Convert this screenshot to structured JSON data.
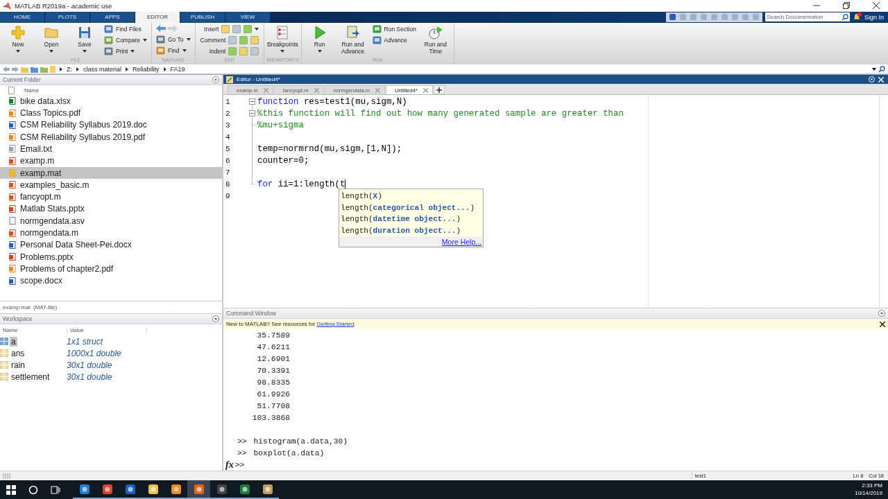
{
  "window": {
    "title": "MATLAB R2019a - academic use"
  },
  "ribbon": {
    "tabs": [
      {
        "label": "HOME",
        "selected": false
      },
      {
        "label": "PLOTS",
        "selected": false
      },
      {
        "label": "APPS",
        "selected": false
      },
      {
        "label": "EDITOR",
        "selected": true
      },
      {
        "label": "PUBLISH",
        "selected": false
      },
      {
        "label": "VIEW",
        "selected": false
      }
    ],
    "search": {
      "placeholder": "Search Documentation"
    },
    "sign_in": "Sign In"
  },
  "toolstrip": {
    "groups": [
      {
        "label": "FILE",
        "items": [
          {
            "kind": "big",
            "label": "New",
            "dropdown": true
          },
          {
            "kind": "big",
            "label": "Open",
            "dropdown": true
          },
          {
            "kind": "big",
            "label": "Save",
            "dropdown": true
          },
          {
            "kind": "stack",
            "buttons": [
              {
                "kind": "text",
                "label": "Find Files",
                "dropdown": false
              },
              {
                "kind": "text",
                "label": "Compare",
                "dropdown": true
              },
              {
                "kind": "text",
                "label": "Print",
                "dropdown": true
              }
            ]
          }
        ]
      },
      {
        "label": "NAVIGATE",
        "items": [
          {
            "kind": "stack",
            "buttons": [
              {
                "kind": "arrows"
              },
              {
                "kind": "text",
                "label": "Go To",
                "dropdown": true
              },
              {
                "kind": "text",
                "label": "Find",
                "dropdown": true
              }
            ]
          }
        ]
      },
      {
        "label": "EDIT",
        "items": [
          {
            "kind": "rows",
            "rows": [
              {
                "label": "Insert",
                "dropdown": true
              },
              {
                "label": "Comment",
                "dropdown": false
              },
              {
                "label": "Indent",
                "dropdown": false
              }
            ]
          }
        ]
      },
      {
        "label": "BREAKPOINTS",
        "items": [
          {
            "kind": "big",
            "label": "Breakpoints",
            "dropdown": true
          }
        ]
      },
      {
        "label": "RUN",
        "items": [
          {
            "kind": "big",
            "label": "Run",
            "dropdown": true
          },
          {
            "kind": "big",
            "label": "Run and Advance",
            "dropdown": false
          },
          {
            "kind": "stack",
            "buttons": [
              {
                "kind": "text",
                "label": "Run Section",
                "dropdown": false
              },
              {
                "kind": "text",
                "label": "Advance",
                "dropdown": false
              }
            ]
          },
          {
            "kind": "big",
            "label": "Run and Time",
            "dropdown": false
          }
        ]
      }
    ]
  },
  "address": {
    "crumbs": [
      "Z:",
      "class material",
      "Reliability",
      "FA19"
    ]
  },
  "current_folder": {
    "title": "Current Folder",
    "column": "Name",
    "files": [
      {
        "name": "bike data.xlsx",
        "kind": "excel",
        "selected": false
      },
      {
        "name": "Class Topics.pdf",
        "kind": "pdf",
        "selected": false
      },
      {
        "name": "CSM Reliability Syllabus 2019.doc",
        "kind": "word",
        "selected": false
      },
      {
        "name": "CSM Reliability Syllabus 2019.pdf",
        "kind": "pdf",
        "selected": false
      },
      {
        "name": "Email.txt",
        "kind": "text",
        "selected": false
      },
      {
        "name": "examp.m",
        "kind": "script",
        "selected": false
      },
      {
        "name": "examp.mat",
        "kind": "mat",
        "selected": true
      },
      {
        "name": "examples_basic.m",
        "kind": "script",
        "selected": false
      },
      {
        "name": "fancyopt.m",
        "kind": "function",
        "selected": false
      },
      {
        "name": "Matlab Stats.pptx",
        "kind": "slides",
        "selected": false
      },
      {
        "name": "normgendata.asv",
        "kind": "blank",
        "selected": false
      },
      {
        "name": "normgendata.m",
        "kind": "function",
        "selected": false
      },
      {
        "name": "Personal Data Sheet-Pei.docx",
        "kind": "word",
        "selected": false
      },
      {
        "name": "Problems.pptx",
        "kind": "slides",
        "selected": false
      },
      {
        "name": "Problems of chapter2.pdf",
        "kind": "pdf",
        "selected": false
      },
      {
        "name": "scope.docx",
        "kind": "word",
        "selected": false
      }
    ],
    "details": "examp.mat  (MAT-file)"
  },
  "workspace": {
    "title": "Workspace",
    "columns": [
      "Name",
      "Value"
    ],
    "rows": [
      {
        "name": "a",
        "value": "1x1 struct",
        "kind": "struct",
        "selected": true
      },
      {
        "name": "ans",
        "value": "1000x1 double",
        "kind": "matrix",
        "selected": false
      },
      {
        "name": "rain",
        "value": "30x1 double",
        "kind": "matrix",
        "selected": false
      },
      {
        "name": "settlement",
        "value": "30x1 double",
        "kind": "matrix",
        "selected": false
      }
    ]
  },
  "editor": {
    "title": "Editor - Untitled4*",
    "tabs": [
      {
        "label": "examp.m",
        "selected": false
      },
      {
        "label": "fancyopt.m",
        "selected": false
      },
      {
        "label": "normgendata.m",
        "selected": false
      },
      {
        "label": "Untitled4*",
        "selected": true
      }
    ],
    "lines": [
      {
        "num": "1",
        "fold_start": true,
        "fold_end": false,
        "cursor": false,
        "segments": [
          {
            "text": "function",
            "kind": "keyword"
          },
          {
            "text": " res=test1(mu,sigm,N)",
            "kind": "plain"
          }
        ]
      },
      {
        "num": "2",
        "fold_start": true,
        "fold_end": false,
        "cursor": false,
        "segments": [
          {
            "text": "%this function will find out how many generated sample are greater than",
            "kind": "comment"
          }
        ]
      },
      {
        "num": "3",
        "fold_start": false,
        "fold_end": true,
        "cursor": false,
        "segments": [
          {
            "text": "%mu+sigma",
            "kind": "comment"
          }
        ]
      },
      {
        "num": "4",
        "fold_start": false,
        "fold_end": false,
        "cursor": false
      },
      {
        "num": "5",
        "fold_start": false,
        "fold_end": false,
        "cursor": false,
        "segments": [
          {
            "text": "temp=normrnd(mu,sigm,[1,N]);",
            "kind": "plain"
          }
        ]
      },
      {
        "num": "6",
        "fold_start": false,
        "fold_end": false,
        "cursor": false,
        "segments": [
          {
            "text": "counter=0;",
            "kind": "plain"
          }
        ]
      },
      {
        "num": "7",
        "fold_start": false,
        "fold_end": false,
        "cursor": false
      },
      {
        "num": "8",
        "fold_start": false,
        "fold_end": true,
        "cursor": true,
        "segments": [
          {
            "text": "for",
            "kind": "keyword"
          },
          {
            "text": " ii=1:length(t",
            "kind": "plain"
          }
        ]
      },
      {
        "num": "9",
        "fold_start": false,
        "fold_end": false,
        "cursor": false
      }
    ],
    "completion": {
      "items": [
        "length(**X**)",
        "length(**categorical object...**)",
        "length(**datetime object...**)",
        "length(**duration object...**)"
      ],
      "more": "More Help..."
    }
  },
  "command_window": {
    "title": "Command Window",
    "notice": {
      "text": "New to MATLAB? See resources for ",
      "link": "Getting Started",
      "end": "."
    },
    "outputs": [
      "35.7589",
      "47.6211",
      "12.6901",
      "70.3391",
      "98.8335",
      "61.9926",
      "51.7708",
      "103.3868"
    ],
    "commands": [
      {
        "prompt": ">>",
        "text": "histogram(a.data,30)"
      },
      {
        "prompt": ">>",
        "text": "boxplot(a.data)"
      }
    ],
    "input": {
      "fx": "fx",
      "prompt": ">>"
    }
  },
  "status_bar": {
    "script": "test1",
    "line": "Ln 8",
    "column": "Col 18"
  },
  "taskbar": {
    "apps": [
      {
        "selected": false
      },
      {
        "selected": false
      },
      {
        "selected": false
      },
      {
        "selected": false
      },
      {
        "selected": false
      },
      {
        "selected": true
      },
      {
        "selected": false
      },
      {
        "selected": false
      },
      {
        "selected": false
      }
    ],
    "time": "2:33 PM",
    "date": "10/14/2019"
  }
}
